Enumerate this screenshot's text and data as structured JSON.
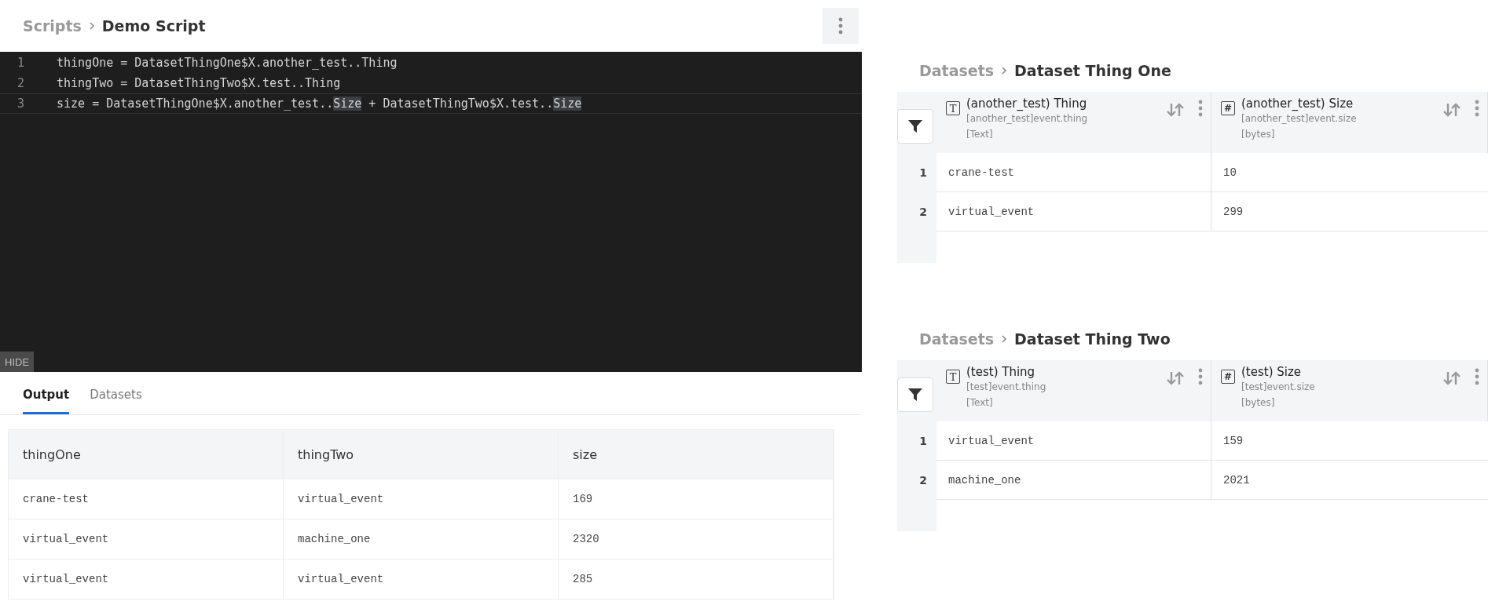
{
  "script_panel": {
    "breadcrumb": {
      "parent": "Scripts",
      "current": "Demo Script"
    },
    "editor": {
      "lines": [
        {
          "number": "1",
          "active": false,
          "segments": [
            {
              "text": "thingOne = DatasetThingOne$X.another_test..Thing",
              "highlighted": false
            }
          ]
        },
        {
          "number": "2",
          "active": false,
          "segments": [
            {
              "text": "thingTwo = DatasetThingTwo$X.test..Thing",
              "highlighted": false
            }
          ]
        },
        {
          "number": "3",
          "active": true,
          "segments": [
            {
              "text": "size = DatasetThingOne$X.another_test..",
              "highlighted": false
            },
            {
              "text": "Size",
              "highlighted": true
            },
            {
              "text": " + DatasetThingTwo$X.test..",
              "highlighted": false
            },
            {
              "text": "Size",
              "highlighted": true
            }
          ]
        }
      ],
      "hide_button": "HIDE"
    },
    "tabs": [
      {
        "label": "Output",
        "selected": true
      },
      {
        "label": "Datasets",
        "selected": false
      }
    ],
    "output_table": {
      "columns": [
        "thingOne",
        "thingTwo",
        "size"
      ],
      "rows": [
        [
          "crane-test",
          "virtual_event",
          "169"
        ],
        [
          "virtual_event",
          "machine_one",
          "2320"
        ],
        [
          "virtual_event",
          "virtual_event",
          "285"
        ]
      ]
    }
  },
  "datasets": [
    {
      "breadcrumb": {
        "parent": "Datasets",
        "current": "Dataset Thing One"
      },
      "columns": [
        {
          "kind": "text",
          "icon": "T",
          "title": "(another_test) Thing",
          "path": "[another_test]event.thing",
          "type": "[Text]"
        },
        {
          "kind": "number",
          "icon": "#",
          "title": "(another_test) Size",
          "path": "[another_test]event.size",
          "type": "[bytes]"
        }
      ],
      "rows": [
        {
          "number": "1",
          "cells": [
            "crane-test",
            "10"
          ]
        },
        {
          "number": "2",
          "cells": [
            "virtual_event",
            "299"
          ]
        }
      ]
    },
    {
      "breadcrumb": {
        "parent": "Datasets",
        "current": "Dataset Thing Two"
      },
      "columns": [
        {
          "kind": "text",
          "icon": "T",
          "title": "(test) Thing",
          "path": "[test]event.thing",
          "type": "[Text]"
        },
        {
          "kind": "number",
          "icon": "#",
          "title": "(test) Size",
          "path": "[test]event.size",
          "type": "[bytes]"
        }
      ],
      "rows": [
        {
          "number": "1",
          "cells": [
            "virtual_event",
            "159"
          ]
        },
        {
          "number": "2",
          "cells": [
            "machine_one",
            "2021"
          ]
        }
      ]
    }
  ]
}
